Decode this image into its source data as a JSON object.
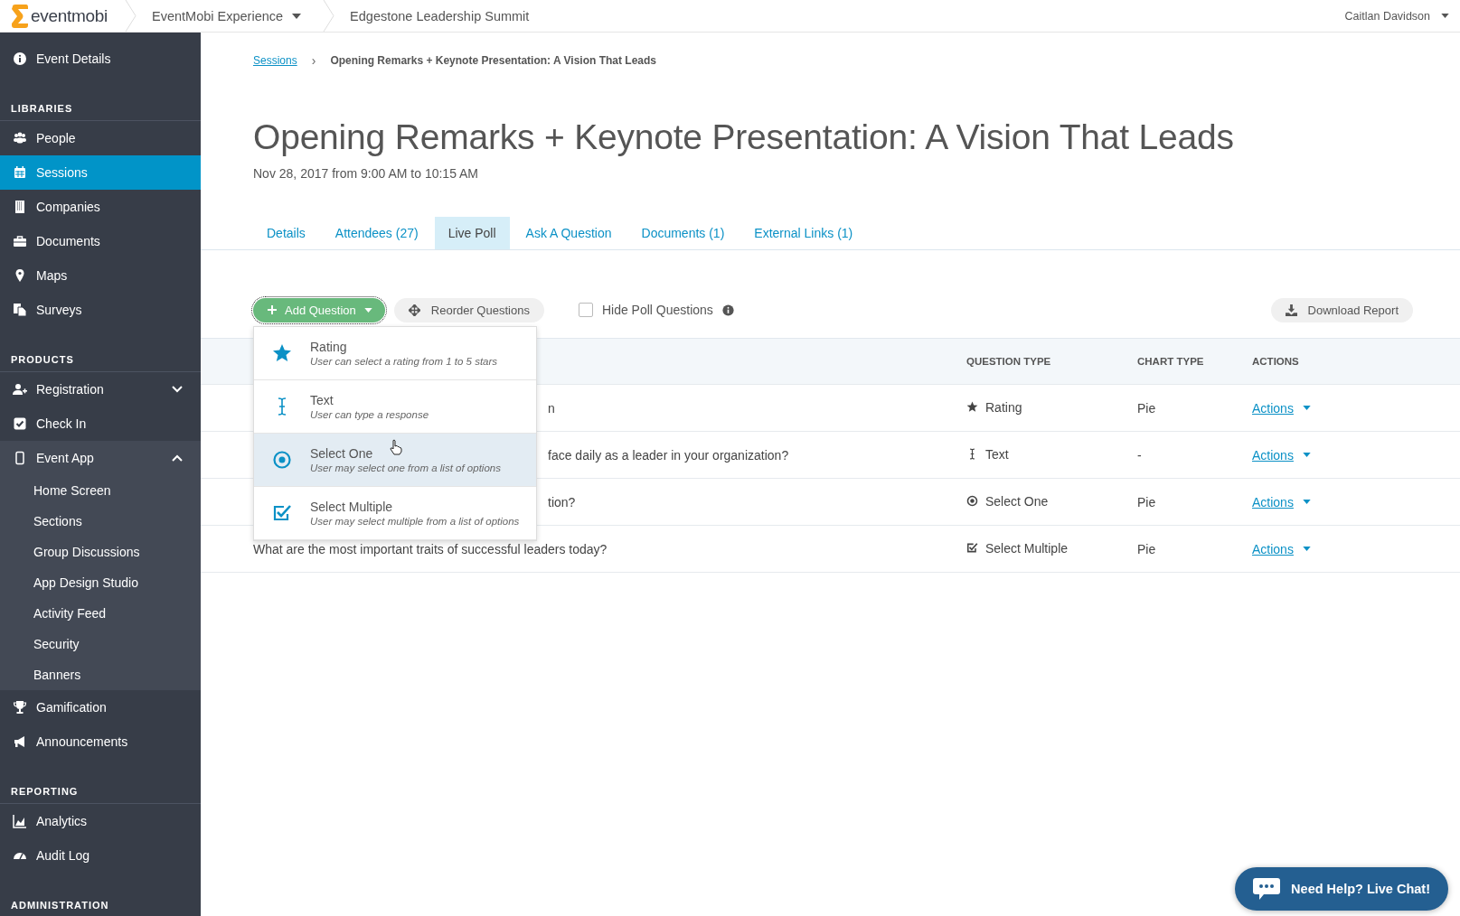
{
  "topbar": {
    "logo": "eventmobi",
    "crumbs": [
      {
        "label": "EventMobi Experience",
        "dropdown": true
      },
      {
        "label": "Edgestone Leadership Summit",
        "dropdown": false
      }
    ],
    "user": "Caitlan Davidson"
  },
  "sidebar": {
    "sections": [
      {
        "items": [
          {
            "label": "Event Details",
            "kind": "info",
            "selected": false
          }
        ]
      },
      {
        "heading": "LIBRARIES",
        "items": [
          {
            "label": "People",
            "kind": "people",
            "selected": false
          },
          {
            "label": "Sessions",
            "kind": "calendar",
            "selected": true
          },
          {
            "label": "Companies",
            "kind": "building",
            "selected": false
          },
          {
            "label": "Documents",
            "kind": "briefcase",
            "selected": false
          },
          {
            "label": "Maps",
            "kind": "pin",
            "selected": false
          },
          {
            "label": "Surveys",
            "kind": "copy",
            "selected": false
          }
        ]
      },
      {
        "heading": "PRODUCTS",
        "items": [
          {
            "label": "Registration",
            "kind": "user-add",
            "selected": false,
            "expanded": false
          },
          {
            "label": "Check In",
            "kind": "check",
            "selected": false
          },
          {
            "label": "Event App",
            "kind": "phone",
            "selected": false,
            "expanded": true,
            "children": [
              {
                "label": "Home Screen",
                "selected": false
              },
              {
                "label": "Sections",
                "selected": false
              },
              {
                "label": "Group Discussions",
                "selected": false
              },
              {
                "label": "App Design Studio",
                "selected": false
              },
              {
                "label": "Activity Feed",
                "selected": false
              },
              {
                "label": "Security",
                "selected": false
              },
              {
                "label": "Banners",
                "selected": false
              }
            ]
          },
          {
            "label": "Gamification",
            "kind": "trophy",
            "selected": false
          },
          {
            "label": "Announcements",
            "kind": "megaphone",
            "selected": false
          }
        ]
      },
      {
        "heading": "REPORTING",
        "items": [
          {
            "label": "Analytics",
            "kind": "chart",
            "selected": false
          },
          {
            "label": "Audit Log",
            "kind": "dashboard",
            "selected": false
          }
        ]
      },
      {
        "heading": "ADMINISTRATION"
      }
    ]
  },
  "breadcrumb": {
    "link": "Sessions",
    "separator": "›",
    "current": "Opening Remarks + Keynote Presentation: A Vision That Leads"
  },
  "title": "Opening Remarks + Keynote Presentation: A Vision That Leads",
  "date": "Nov 28, 2017 from 9:00 AM to 10:15 AM",
  "tabs": [
    {
      "label": "Details",
      "selected": false
    },
    {
      "label": "Attendees (27)",
      "selected": false
    },
    {
      "label": "Live Poll",
      "selected": true
    },
    {
      "label": "Ask A Question",
      "selected": false
    },
    {
      "label": "Documents (1)",
      "selected": false
    },
    {
      "label": "External Links (1)",
      "selected": false
    }
  ],
  "toolbar": {
    "add": "Add Question",
    "reorder": "Reorder Questions",
    "hide": {
      "label": "Hide Poll Questions",
      "checked": false
    },
    "download": "Download Report"
  },
  "menu": [
    {
      "kind": "rating",
      "title": "Rating",
      "hint": "User can select a rating from 1 to 5 stars",
      "selected": false
    },
    {
      "kind": "text",
      "title": "Text",
      "hint": "User can type a response",
      "selected": false
    },
    {
      "kind": "select-one",
      "title": "Select One",
      "hint": "User may select one from a list of options",
      "selected": true
    },
    {
      "kind": "select-multiple",
      "title": "Select Multiple",
      "hint": "User may select multiple from a list of options",
      "selected": false
    }
  ],
  "table": {
    "columns": [
      "QUESTION TYPE",
      "CHART TYPE",
      "ACTIONS"
    ],
    "rows": [
      {
        "question": "n",
        "covered": true,
        "type": "Rating",
        "kind": "rating",
        "chart": "Pie",
        "action": "Actions"
      },
      {
        "question": "face daily as a leader in your organization?",
        "covered": true,
        "type": "Text",
        "kind": "text",
        "chart": "-",
        "action": "Actions"
      },
      {
        "question": "tion?",
        "covered": true,
        "type": "Select One",
        "kind": "select-one",
        "chart": "Pie",
        "action": "Actions"
      },
      {
        "question": "What are the most important traits of successful leaders today?",
        "covered": false,
        "type": "Select Multiple",
        "kind": "select-multiple",
        "chart": "Pie",
        "action": "Actions"
      }
    ]
  },
  "chat": "Need Help? Live Chat!"
}
